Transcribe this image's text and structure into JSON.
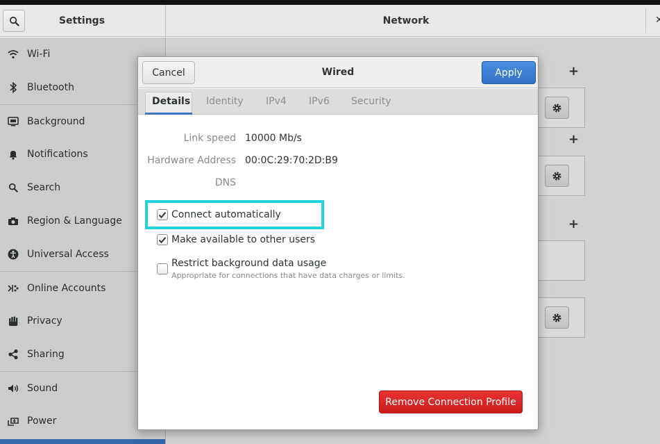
{
  "header": {
    "left_title": "Settings",
    "right_title": "Network",
    "close_glyph": "✕"
  },
  "sidebar": {
    "items": [
      {
        "label": "Wi-Fi",
        "icon": "wifi-icon"
      },
      {
        "label": "Bluetooth",
        "icon": "bluetooth-icon"
      },
      {
        "label": "Background",
        "icon": "background-icon"
      },
      {
        "label": "Notifications",
        "icon": "bell-icon"
      },
      {
        "label": "Search",
        "icon": "search-icon"
      },
      {
        "label": "Region & Language",
        "icon": "camera-icon"
      },
      {
        "label": "Universal Access",
        "icon": "accessibility-icon"
      },
      {
        "label": "Online Accounts",
        "icon": "online-accounts-icon"
      },
      {
        "label": "Privacy",
        "icon": "hand-icon"
      },
      {
        "label": "Sharing",
        "icon": "share-icon"
      },
      {
        "label": "Sound",
        "icon": "speaker-icon"
      },
      {
        "label": "Power",
        "icon": "power-icon"
      }
    ]
  },
  "main": {
    "plus_glyph": "+"
  },
  "dialog": {
    "title": "Wired",
    "cancel_label": "Cancel",
    "apply_label": "Apply",
    "tabs": [
      {
        "label": "Details",
        "active": true
      },
      {
        "label": "Identity",
        "active": false
      },
      {
        "label": "IPv4",
        "active": false
      },
      {
        "label": "IPv6",
        "active": false
      },
      {
        "label": "Security",
        "active": false
      }
    ],
    "details": {
      "link_speed_label": "Link speed",
      "link_speed_value": "10000 Mb/s",
      "hw_address_label": "Hardware Address",
      "hw_address_value": "00:0C:29:70:2D:B9",
      "dns_label": "DNS"
    },
    "options": [
      {
        "label": "Connect automatically",
        "checked": true
      },
      {
        "label": "Make available to other users",
        "checked": true
      },
      {
        "label": "Restrict background data usage",
        "checked": false,
        "sublabel": "Appropriate for connections that have data charges or limits."
      }
    ],
    "remove_label": "Remove Connection Profile"
  },
  "colors": {
    "accent": "#3d76c4",
    "apply": "#3a7bd5",
    "destructive": "#d92424",
    "highlight": "#23d3dc"
  }
}
